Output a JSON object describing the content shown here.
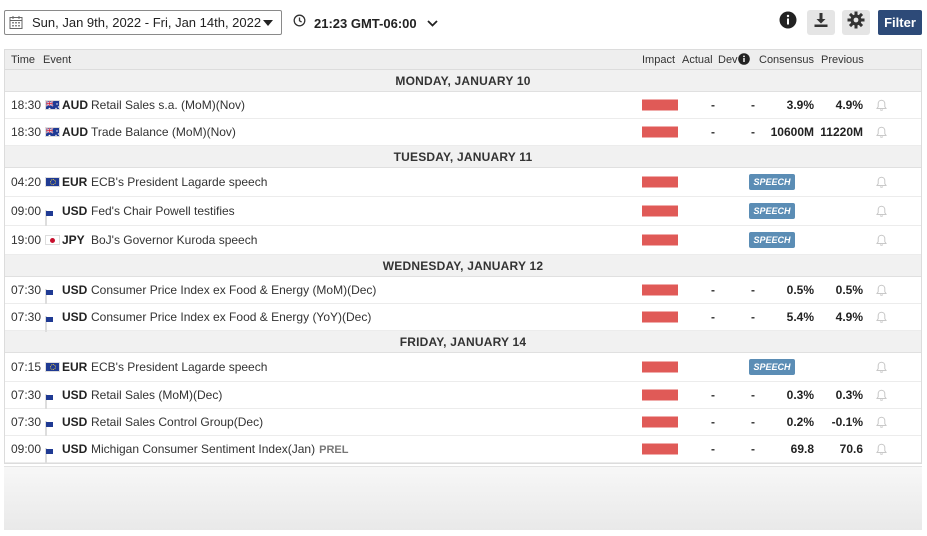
{
  "toolbar": {
    "date_range": "Sun, Jan 9th, 2022 -  Fri, Jan 14th, 2022",
    "time": "21:23 GMT-06:00",
    "filter_label": "Filter"
  },
  "columns": {
    "time": "Time",
    "event": "Event",
    "impact": "Impact",
    "actual": "Actual",
    "dev": "Dev",
    "consensus": "Consensus",
    "previous": "Previous"
  },
  "colors": {
    "impact_high": "#e05a57",
    "filter_bg": "#2d4a78",
    "speech_badge": "#5b8db5"
  },
  "days": [
    {
      "label": "MONDAY, JANUARY 10",
      "events": [
        {
          "time": "18:30",
          "flag": "au",
          "currency": "AUD",
          "event": "Retail Sales s.a. (MoM)(Nov)",
          "actual": "-",
          "dev": "-",
          "consensus": "3.9%",
          "previous": "4.9%"
        },
        {
          "time": "18:30",
          "flag": "au",
          "currency": "AUD",
          "event": "Trade Balance (MoM)(Nov)",
          "actual": "-",
          "dev": "-",
          "consensus": "10600M",
          "previous": "11220M"
        }
      ]
    },
    {
      "label": "TUESDAY, JANUARY 11",
      "events": [
        {
          "time": "04:20",
          "flag": "eu",
          "currency": "EUR",
          "event": "ECB's President Lagarde speech",
          "badge": "SPEECH"
        },
        {
          "time": "09:00",
          "flag": "us",
          "currency": "USD",
          "event": "Fed's Chair Powell testifies",
          "badge": "SPEECH"
        },
        {
          "time": "19:00",
          "flag": "jp",
          "currency": "JPY",
          "event": "BoJ's Governor Kuroda speech",
          "badge": "SPEECH"
        }
      ]
    },
    {
      "label": "WEDNESDAY, JANUARY 12",
      "events": [
        {
          "time": "07:30",
          "flag": "us",
          "currency": "USD",
          "event": "Consumer Price Index ex Food & Energy (MoM)(Dec)",
          "actual": "-",
          "dev": "-",
          "consensus": "0.5%",
          "previous": "0.5%"
        },
        {
          "time": "07:30",
          "flag": "us",
          "currency": "USD",
          "event": "Consumer Price Index ex Food & Energy (YoY)(Dec)",
          "actual": "-",
          "dev": "-",
          "consensus": "5.4%",
          "previous": "4.9%"
        }
      ]
    },
    {
      "label": "FRIDAY, JANUARY 14",
      "events": [
        {
          "time": "07:15",
          "flag": "eu",
          "currency": "EUR",
          "event": "ECB's President Lagarde speech",
          "badge": "SPEECH"
        },
        {
          "time": "07:30",
          "flag": "us",
          "currency": "USD",
          "event": "Retail Sales (MoM)(Dec)",
          "actual": "-",
          "dev": "-",
          "consensus": "0.3%",
          "previous": "0.3%"
        },
        {
          "time": "07:30",
          "flag": "us",
          "currency": "USD",
          "event": "Retail Sales Control Group(Dec)",
          "actual": "-",
          "dev": "-",
          "consensus": "0.2%",
          "previous": "-0.1%"
        },
        {
          "time": "09:00",
          "flag": "us",
          "currency": "USD",
          "event": "Michigan Consumer Sentiment Index(Jan)",
          "tag": "PREL",
          "actual": "-",
          "dev": "-",
          "consensus": "69.8",
          "previous": "70.6"
        }
      ]
    }
  ]
}
